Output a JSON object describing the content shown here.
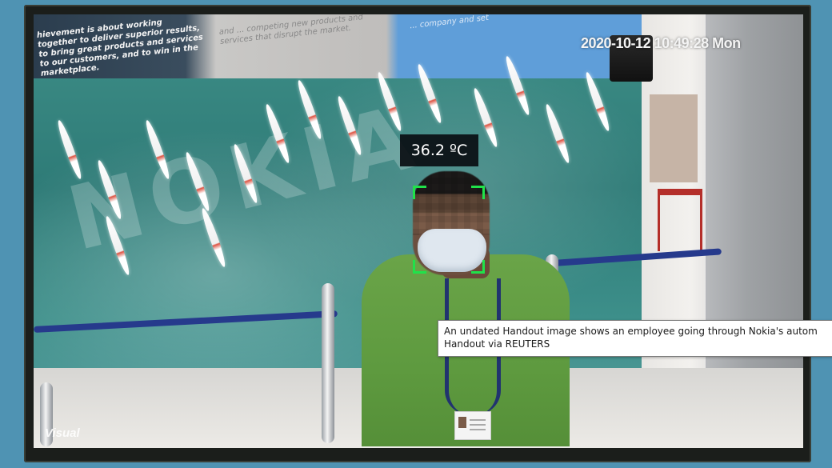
{
  "screen": {
    "timestamp": "2020-10-12 10:49:28 Mon",
    "temperature": "36.2 ºC",
    "watermark": "Visual",
    "mural_brand": "NOKIA",
    "band_left_text": "hievement is about working together to deliver superior results, to bring great products and services to our customers, and to win in the marketplace.",
    "band_mid_text": "and ... competing new products and services that disrupt the market.",
    "band_right_text": "... company and set"
  },
  "caption": {
    "line1": "An undated Handout image shows an employee going through Nokia's autom",
    "line2": "Handout via REUTERS"
  },
  "colors": {
    "detect_box": "#20e24a",
    "page_bg": "#4f93b3"
  }
}
